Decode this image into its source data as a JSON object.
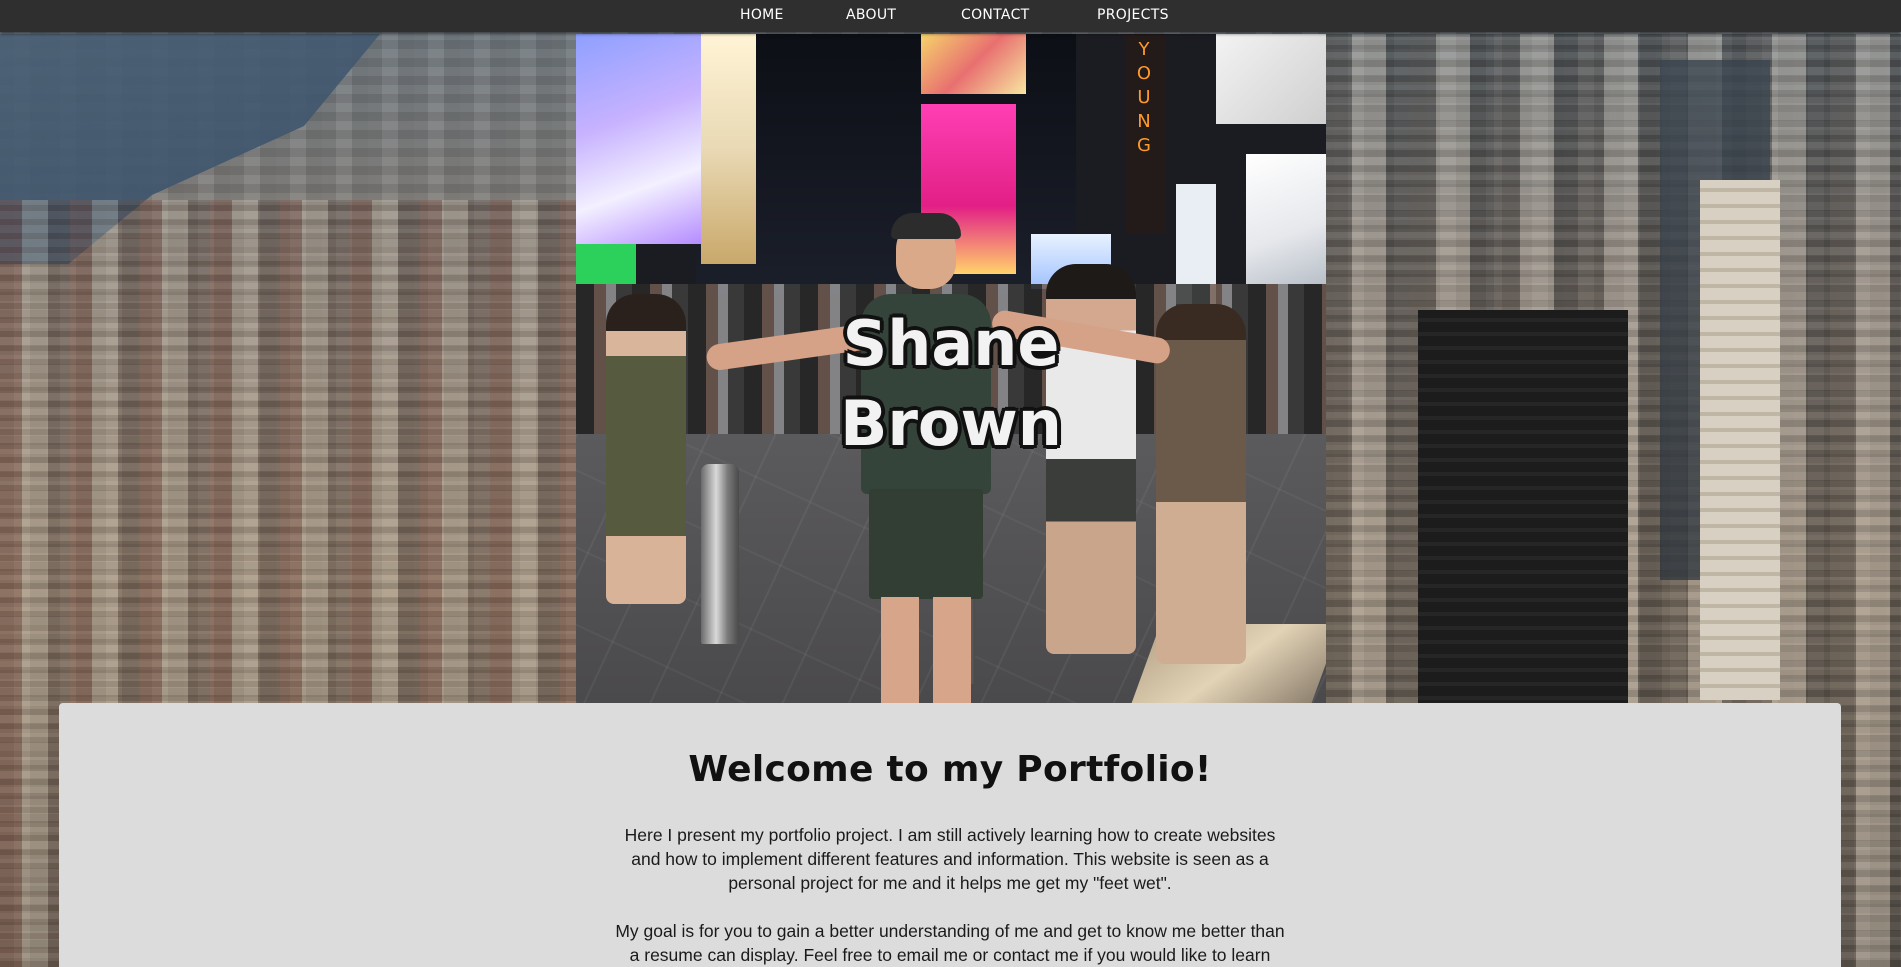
{
  "nav": {
    "items": [
      {
        "label": "HOME"
      },
      {
        "label": "ABOUT"
      },
      {
        "label": "CONTACT"
      },
      {
        "label": "PROJECTS"
      }
    ]
  },
  "hero": {
    "name_line1": "Shane",
    "name_line2": "Brown",
    "billboard_text": "YOUNG"
  },
  "content": {
    "title": "Welcome to my Portfolio!",
    "paragraph1": [
      "Here I present my portfolio project. I am still actively learning how to create websites",
      "and how to implement different features and information. This website is seen as a",
      "personal project for me and it helps me get my \"feet wet\"."
    ],
    "paragraph2": [
      "My goal is for you to gain a better understanding of me and get to know me better than",
      "a resume can display. Feel free to email me or contact me if you would like to learn"
    ]
  },
  "colors": {
    "navbar_bg": "#2f2f2f",
    "nav_text": "#ffffff",
    "card_bg": "#dcdcdc",
    "title_text": "#111111"
  }
}
